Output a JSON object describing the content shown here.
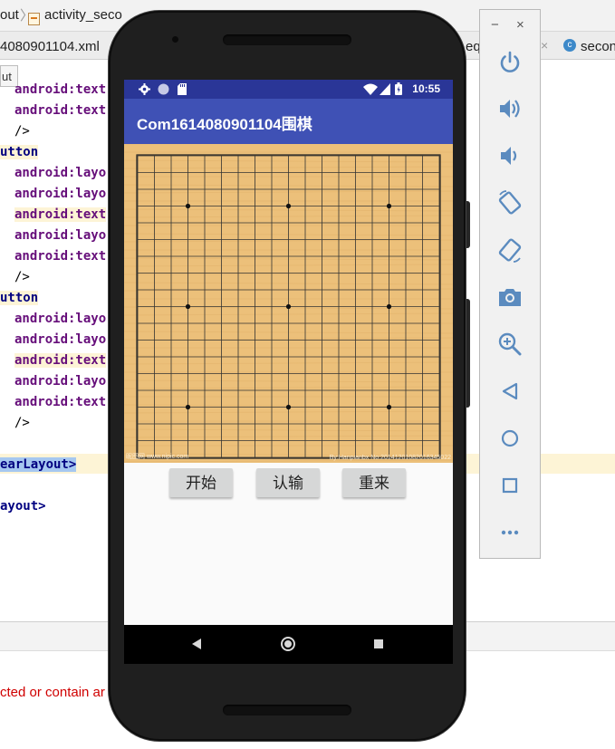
{
  "ide": {
    "breadcrumb_left": "out",
    "breadcrumb_file": "activity_seco",
    "tab_left": "4080901104.xml",
    "tab_right_partial": "eq",
    "tab_right_close": "×",
    "tab_class": "secon",
    "tooltip": "ut",
    "code_lines": [
      "android:text",
      "android:text",
      "/>",
      "utton",
      "android:layo",
      "android:layo",
      "android:text",
      "android:layo",
      "android:text",
      "/>",
      "utton",
      "android:layo",
      "android:layo",
      "android:text",
      "android:layo",
      "android:text",
      "/>",
      "earLayout>",
      "ayout>"
    ],
    "error_text": "cted or contain ar"
  },
  "phone": {
    "status_time": "10:55",
    "app_title": "Com1614080901104围棋",
    "buttons": {
      "start": "开始",
      "resign": "认输",
      "restart": "重来"
    },
    "watermark_left": "昵图网 www.nipic.com",
    "watermark_right": "By:Hanpianbx No:20141201082016345022"
  },
  "emulator_toolbar": {
    "minimize": "−",
    "close": "×",
    "buttons": [
      "power-icon",
      "volume-up-icon",
      "volume-down-icon",
      "rotate-left-icon",
      "rotate-right-icon",
      "camera-icon",
      "zoom-icon",
      "back-icon",
      "home-icon",
      "overview-icon",
      "more-icon"
    ]
  },
  "colors": {
    "status_bar": "#2a3697",
    "app_bar": "#3f51b5",
    "board": "#ecc07a",
    "button": "#d6d7d7"
  }
}
